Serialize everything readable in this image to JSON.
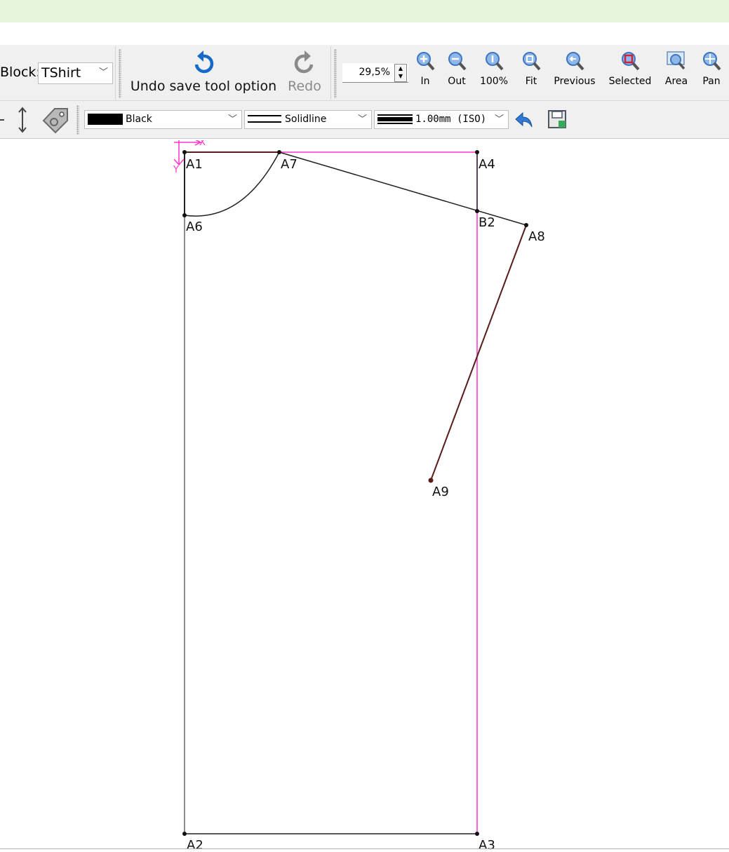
{
  "toolbar": {
    "block_label": "Block:",
    "block_value": "TShirt",
    "undo_label": "Undo save tool option",
    "redo_label": "Redo",
    "zoom_value": "29,5%",
    "zoom_buttons": [
      "In",
      "Out",
      "100%",
      "Fit",
      "Previous",
      "Selected",
      "Area",
      "Pan"
    ]
  },
  "properties": {
    "color": "Black",
    "line_type": "Solidline",
    "line_weight": "1.00mm (ISO)"
  },
  "canvas": {
    "axis_x": "X",
    "axis_y": "Y",
    "points": {
      "A1": "A1",
      "A2": "A2",
      "A3": "A3",
      "A4": "A4",
      "A6": "A6",
      "A7": "A7",
      "A8": "A8",
      "A9": "A9",
      "B2": "B2"
    }
  },
  "colors": {
    "accent_pink": "#ff33cc",
    "line_dark": "#222222",
    "line_brown": "#5a1a1a",
    "titlebar_bg": "#e8f5de",
    "toolbar_bg": "#f0f0f0"
  }
}
